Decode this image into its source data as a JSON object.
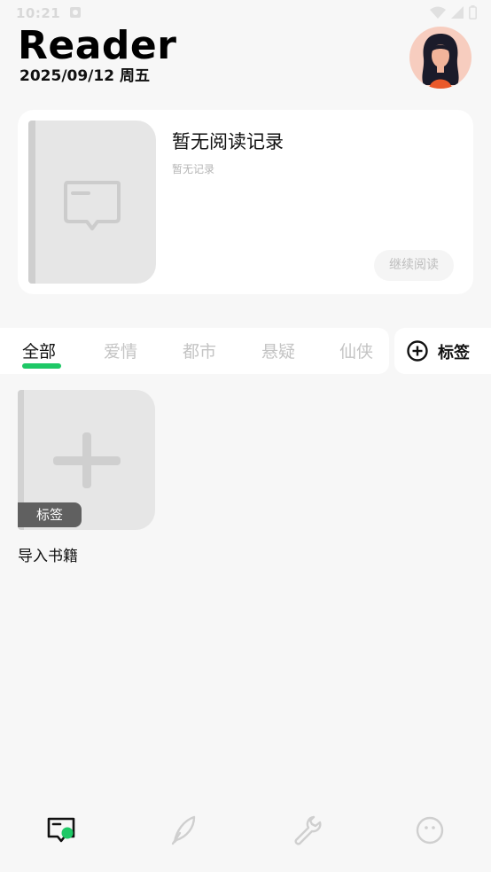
{
  "status": {
    "time": "10:21"
  },
  "header": {
    "title": "Reader",
    "date": "2025/09/12 周五"
  },
  "recent": {
    "title": "暂无阅读记录",
    "subtitle": "暂无记录",
    "continue_label": "继续阅读"
  },
  "tabs": [
    {
      "label": "全部",
      "active": true
    },
    {
      "label": "爱情",
      "active": false
    },
    {
      "label": "都市",
      "active": false
    },
    {
      "label": "悬疑",
      "active": false
    },
    {
      "label": "仙侠",
      "active": false
    }
  ],
  "tag_button": {
    "label": "标签",
    "icon": "plus-circle-icon"
  },
  "import_book": {
    "badge": "标签",
    "label": "导入书籍",
    "icon": "plus-icon"
  },
  "nav": [
    {
      "icon": "bookshelf-icon",
      "active": true
    },
    {
      "icon": "feather-icon",
      "active": false
    },
    {
      "icon": "wrench-icon",
      "active": false
    },
    {
      "icon": "face-icon",
      "active": false
    }
  ],
  "colors": {
    "accent": "#1ec866",
    "inactive": "#c4c4c4",
    "background": "#f7f7f7"
  }
}
